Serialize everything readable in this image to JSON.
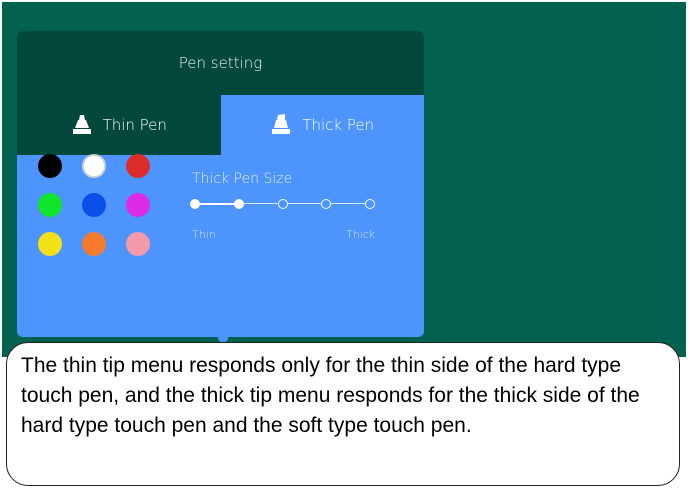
{
  "panel": {
    "title": "Pen setting",
    "tabs": [
      {
        "label": "Thin Pen",
        "icon": "pen-tip-icon",
        "selected": false
      },
      {
        "label": "Thick Pen",
        "icon": "pen-tip-icon",
        "selected": true
      }
    ],
    "colors": [
      {
        "name": "black",
        "hex": "#000000",
        "selected": false
      },
      {
        "name": "white",
        "hex": "#ffffff",
        "selected": true
      },
      {
        "name": "red",
        "hex": "#dd2a2a",
        "selected": false
      },
      {
        "name": "green",
        "hex": "#11e52b",
        "selected": false
      },
      {
        "name": "blue",
        "hex": "#0a4fe8",
        "selected": false
      },
      {
        "name": "magenta",
        "hex": "#dd2ae6",
        "selected": false
      },
      {
        "name": "yellow",
        "hex": "#f4e018",
        "selected": false
      },
      {
        "name": "orange",
        "hex": "#f57a2c",
        "selected": false
      },
      {
        "name": "pink",
        "hex": "#f59aa8",
        "selected": false
      }
    ],
    "size": {
      "label": "Thick Pen Size",
      "steps": 5,
      "selected_step": 2,
      "min_label": "Thin",
      "max_label": "Thick"
    }
  },
  "callout": {
    "text": "The thin tip menu responds only for the thin side of the hard type touch pen, and the thick tip menu responds for the thick side of the hard type touch pen and the soft type touch pen."
  },
  "theme": {
    "screen_bg": "#02614f",
    "header_bg": "#03493b",
    "accent": "#4d94ff"
  }
}
